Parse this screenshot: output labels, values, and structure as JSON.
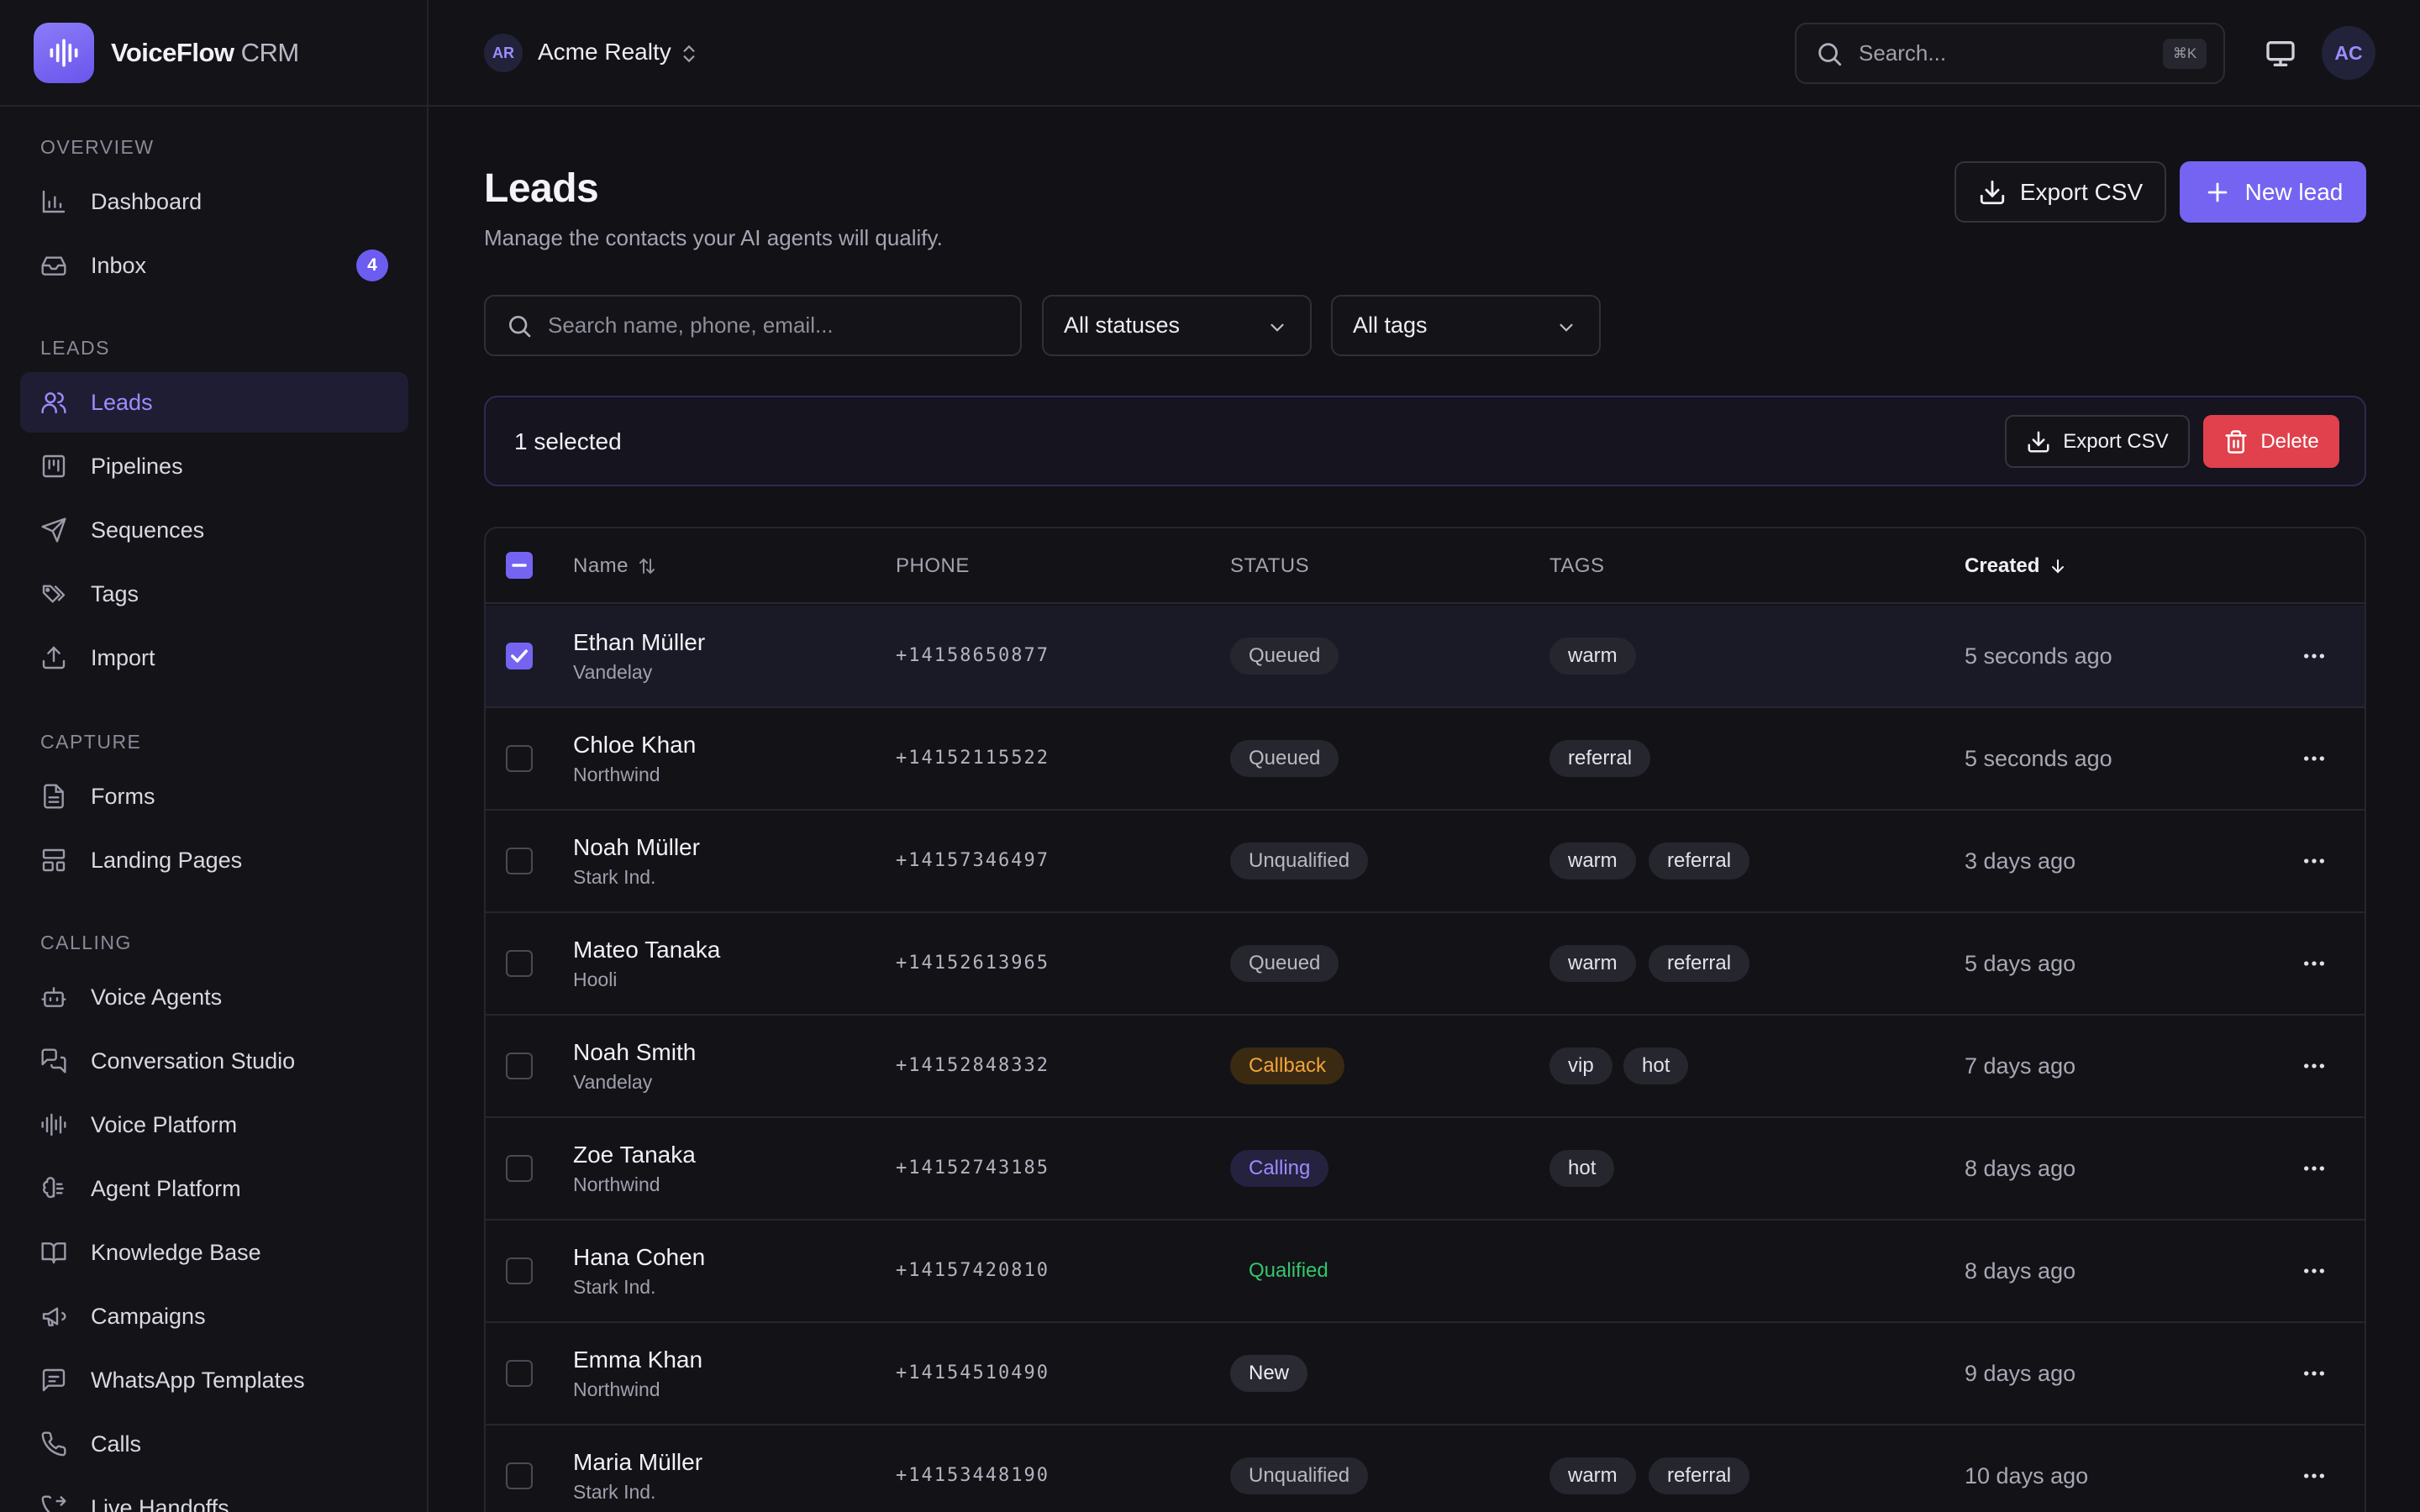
{
  "brand": {
    "name": "VoiceFlow",
    "name_suffix": " CRM"
  },
  "workspace": {
    "initials": "AR",
    "name": "Acme Realty"
  },
  "topbar": {
    "search_placeholder": "Search...",
    "search_shortcut": "⌘K",
    "user_initials": "AC"
  },
  "sidebar": {
    "sections": {
      "overview": "OVERVIEW",
      "leads": "LEADS",
      "capture": "CAPTURE",
      "calling": "CALLING"
    },
    "items": [
      {
        "label": "Dashboard",
        "icon": "bar-chart-icon"
      },
      {
        "label": "Inbox",
        "icon": "inbox-icon",
        "badge": "4"
      },
      {
        "label": "Leads",
        "icon": "users-icon",
        "active": true
      },
      {
        "label": "Pipelines",
        "icon": "kanban-icon"
      },
      {
        "label": "Sequences",
        "icon": "send-icon"
      },
      {
        "label": "Tags",
        "icon": "tags-icon"
      },
      {
        "label": "Import",
        "icon": "upload-icon"
      },
      {
        "label": "Forms",
        "icon": "file-text-icon"
      },
      {
        "label": "Landing Pages",
        "icon": "layout-icon"
      },
      {
        "label": "Voice Agents",
        "icon": "bot-icon"
      },
      {
        "label": "Conversation Studio",
        "icon": "chat-icon"
      },
      {
        "label": "Voice Platform",
        "icon": "waveform-icon"
      },
      {
        "label": "Agent Platform",
        "icon": "brain-icon"
      },
      {
        "label": "Knowledge Base",
        "icon": "book-icon"
      },
      {
        "label": "Campaigns",
        "icon": "megaphone-icon"
      },
      {
        "label": "WhatsApp Templates",
        "icon": "message-square-icon"
      },
      {
        "label": "Calls",
        "icon": "phone-icon"
      },
      {
        "label": "Live Handoffs",
        "icon": "phone-forward-icon"
      }
    ]
  },
  "page": {
    "title": "Leads",
    "subtitle": "Manage the contacts your AI agents will qualify.",
    "export_label": "Export CSV",
    "new_lead_label": "New lead"
  },
  "filters": {
    "search_placeholder": "Search name, phone, email...",
    "status_value": "All statuses",
    "tags_value": "All tags"
  },
  "selection": {
    "count_text": "1 selected",
    "export_label": "Export CSV",
    "delete_label": "Delete"
  },
  "table": {
    "headers": {
      "name": "Name",
      "phone": "PHONE",
      "status": "STATUS",
      "tags": "TAGS",
      "created": "Created"
    },
    "rows": [
      {
        "name": "Ethan Müller",
        "company": "Vandelay",
        "phone": "+14158650877",
        "status": "Queued",
        "status_kind": "gray",
        "tags": [
          "warm"
        ],
        "created": "5 seconds ago",
        "selected": true
      },
      {
        "name": "Chloe Khan",
        "company": "Northwind",
        "phone": "+14152115522",
        "status": "Queued",
        "status_kind": "gray",
        "tags": [
          "referral"
        ],
        "created": "5 seconds ago",
        "selected": false
      },
      {
        "name": "Noah Müller",
        "company": "Stark Ind.",
        "phone": "+14157346497",
        "status": "Unqualified",
        "status_kind": "gray",
        "tags": [
          "warm",
          "referral"
        ],
        "created": "3 days ago",
        "selected": false
      },
      {
        "name": "Mateo Tanaka",
        "company": "Hooli",
        "phone": "+14152613965",
        "status": "Queued",
        "status_kind": "gray",
        "tags": [
          "warm",
          "referral"
        ],
        "created": "5 days ago",
        "selected": false
      },
      {
        "name": "Noah Smith",
        "company": "Vandelay",
        "phone": "+14152848332",
        "status": "Callback",
        "status_kind": "callback",
        "tags": [
          "vip",
          "hot"
        ],
        "created": "7 days ago",
        "selected": false
      },
      {
        "name": "Zoe Tanaka",
        "company": "Northwind",
        "phone": "+14152743185",
        "status": "Calling",
        "status_kind": "calling",
        "tags": [
          "hot"
        ],
        "created": "8 days ago",
        "selected": false
      },
      {
        "name": "Hana Cohen",
        "company": "Stark Ind.",
        "phone": "+14157420810",
        "status": "Qualified",
        "status_kind": "qualified",
        "tags": [],
        "created": "8 days ago",
        "selected": false
      },
      {
        "name": "Emma Khan",
        "company": "Northwind",
        "phone": "+14154510490",
        "status": "New",
        "status_kind": "new",
        "tags": [],
        "created": "9 days ago",
        "selected": false
      },
      {
        "name": "Maria Müller",
        "company": "Stark Ind.",
        "phone": "+14153448190",
        "status": "Unqualified",
        "status_kind": "gray",
        "tags": [
          "warm",
          "referral"
        ],
        "created": "10 days ago",
        "selected": false
      }
    ]
  },
  "colors": {
    "accent": "#7564f2",
    "danger": "#e0414c",
    "callback": "#f2a43a",
    "qualified": "#35c56b"
  }
}
